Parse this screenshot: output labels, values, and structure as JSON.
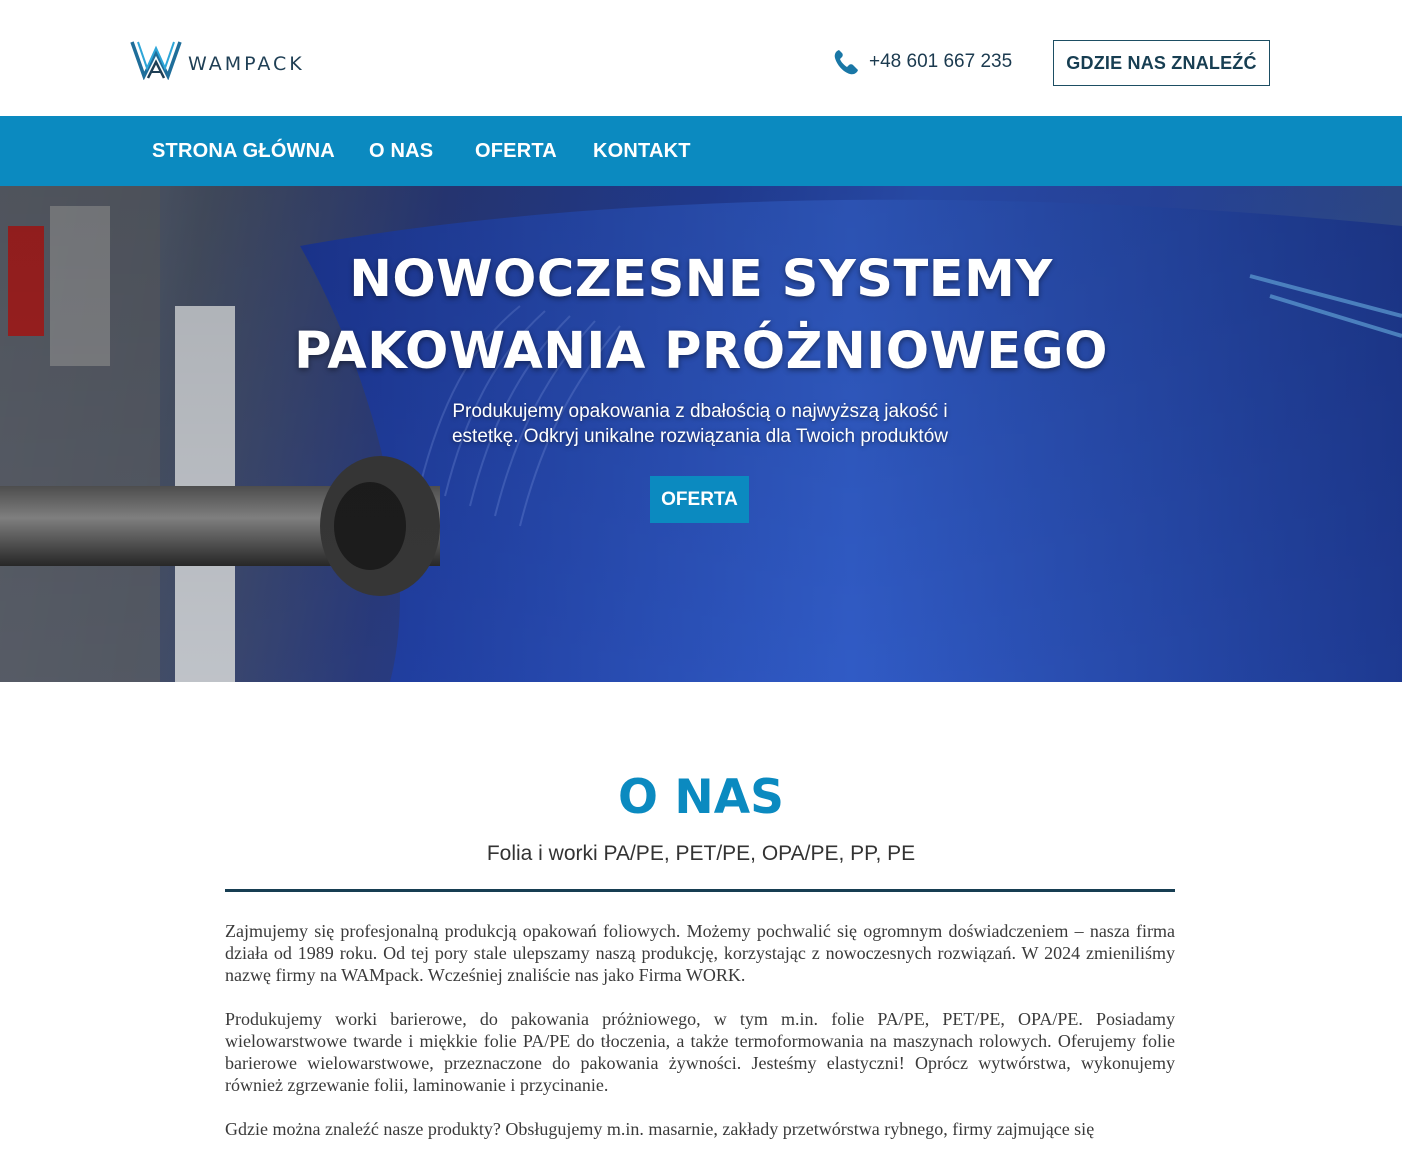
{
  "header": {
    "logo_text": "WAMPACK",
    "phone": "+48 601 667 235",
    "find_us_button": "GDZIE NAS ZNALEŹĆ"
  },
  "nav": {
    "items": [
      {
        "label": "STRONA GŁÓWNA"
      },
      {
        "label": "O NAS"
      },
      {
        "label": "OFERTA"
      },
      {
        "label": "KONTAKT"
      }
    ]
  },
  "hero": {
    "title_line1": "NOWOCZESNE SYSTEMY",
    "title_line2": "PAKOWANIA PRÓŻNIOWEGO",
    "subtitle": "Produkujemy opakowania z dbałością o najwyższą jakość i estetkę. Odkryj unikalne rozwiązania dla Twoich produktów",
    "button": "OFERTA"
  },
  "about": {
    "title": "O NAS",
    "subtitle": "Folia i worki PA/PE, PET/PE, OPA/PE, PP, PE",
    "paragraphs": [
      "Zajmujemy się profesjonalną produkcją opakowań foliowych. Możemy pochwalić się ogromnym doświadczeniem – nasza firma działa od 1989 roku. Od tej pory stale ulepszamy naszą produkcję, korzystając z nowoczesnych rozwiązań. W 2024 zmieniliśmy nazwę firmy na WAMpack. Wcześniej znaliście nas jako Firma WORK.",
      "Produkujemy worki barierowe, do pakowania próżniowego, w tym m.in. folie PA/PE, PET/PE, OPA/PE. Posiadamy wielowarstwowe twarde i miękkie folie PA/PE do tłoczenia, a także termoformowania na maszynach rolowych. Oferujemy folie barierowe wielowarstwowe, przeznaczone do pakowania żywności. Jesteśmy elastyczni! Oprócz wytwórstwa, wykonujemy również zgrzewanie folii, laminowanie i przycinanie.",
      "Gdzie można znaleźć nasze produkty? Obsługujemy m.in. masarnie, zakłady przetwórstwa rybnego, firmy zajmujące się"
    ]
  },
  "colors": {
    "accent": "#0b8ac0",
    "dark": "#173e52"
  }
}
